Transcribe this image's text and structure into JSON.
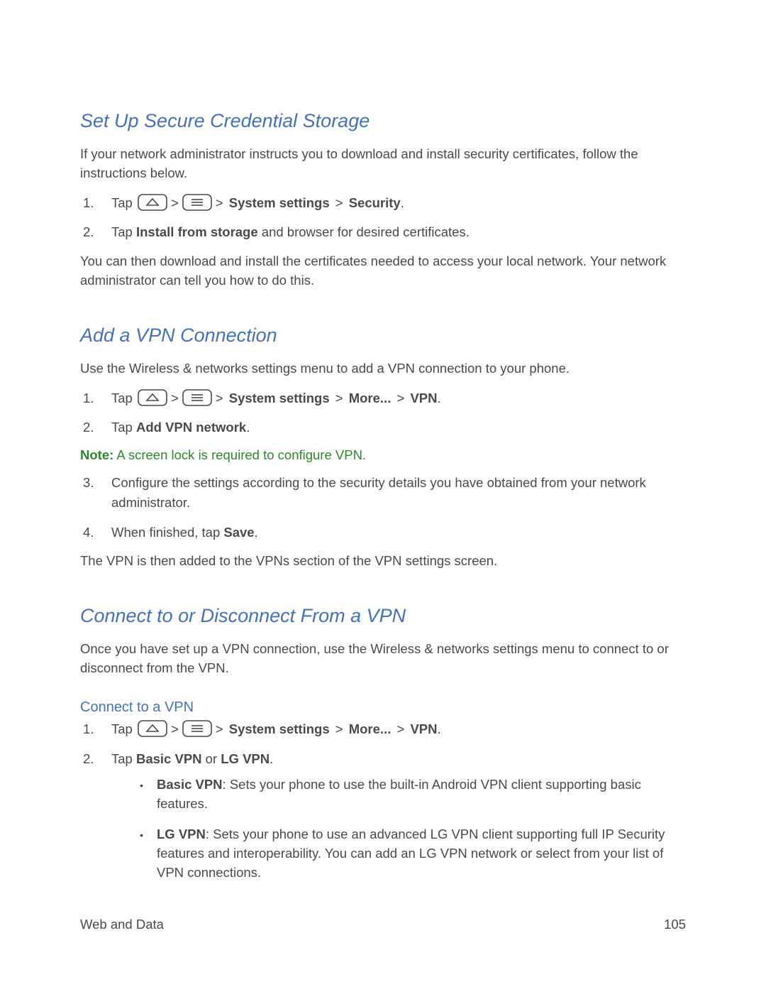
{
  "section1": {
    "heading": "Set Up Secure Credential Storage",
    "intro": "If your network administrator instructs you to download and install security certificates, follow the instructions below.",
    "step1_prefix": "Tap ",
    "step1_system": "System settings",
    "step1_security": "Security",
    "step2_prefix": "Tap ",
    "step2_bold": "Install from storage",
    "step2_suffix": " and browser for desired certificates.",
    "outro": "You can then download and install the certificates needed to access your local network. Your network administrator can tell you how to do this."
  },
  "section2": {
    "heading": "Add a VPN Connection",
    "intro": "Use the Wireless & networks settings menu to add a VPN connection to your phone.",
    "step1_prefix": "Tap ",
    "step1_system": "System settings",
    "step1_more": "More...",
    "step1_vpn": "VPN",
    "step2_prefix": "Tap ",
    "step2_bold": "Add VPN network",
    "note_label": "Note:",
    "note_text": "  A screen lock is required to configure VPN.",
    "step3": "Configure the settings according to the security details you have obtained from your network administrator.",
    "step4_prefix": "When finished, tap ",
    "step4_bold": "Save",
    "outro": "The VPN is then added to the VPNs section of the VPN settings screen."
  },
  "section3": {
    "heading": "Connect to or Disconnect From a VPN",
    "intro": "Once you have set up a VPN connection, use the Wireless & networks settings menu to connect to or disconnect from the VPN.",
    "sub_heading": "Connect to a VPN",
    "step1_prefix": "Tap ",
    "step1_system": "System settings",
    "step1_more": "More...",
    "step1_vpn": "VPN",
    "step2_prefix": "Tap ",
    "step2_basic": "Basic VPN",
    "step2_or": " or ",
    "step2_lg": "LG VPN",
    "bullet1_bold": "Basic VPN",
    "bullet1_text": ": Sets your phone to use the built-in Android VPN client supporting basic features.",
    "bullet2_bold": "LG VPN",
    "bullet2_text": ": Sets your phone to use an advanced LG VPN client supporting full IP Security features and interoperability. You can add an LG VPN network or select from your list of VPN connections."
  },
  "footer": {
    "left": "Web and Data",
    "right": "105"
  },
  "gt": ">",
  "period": "."
}
